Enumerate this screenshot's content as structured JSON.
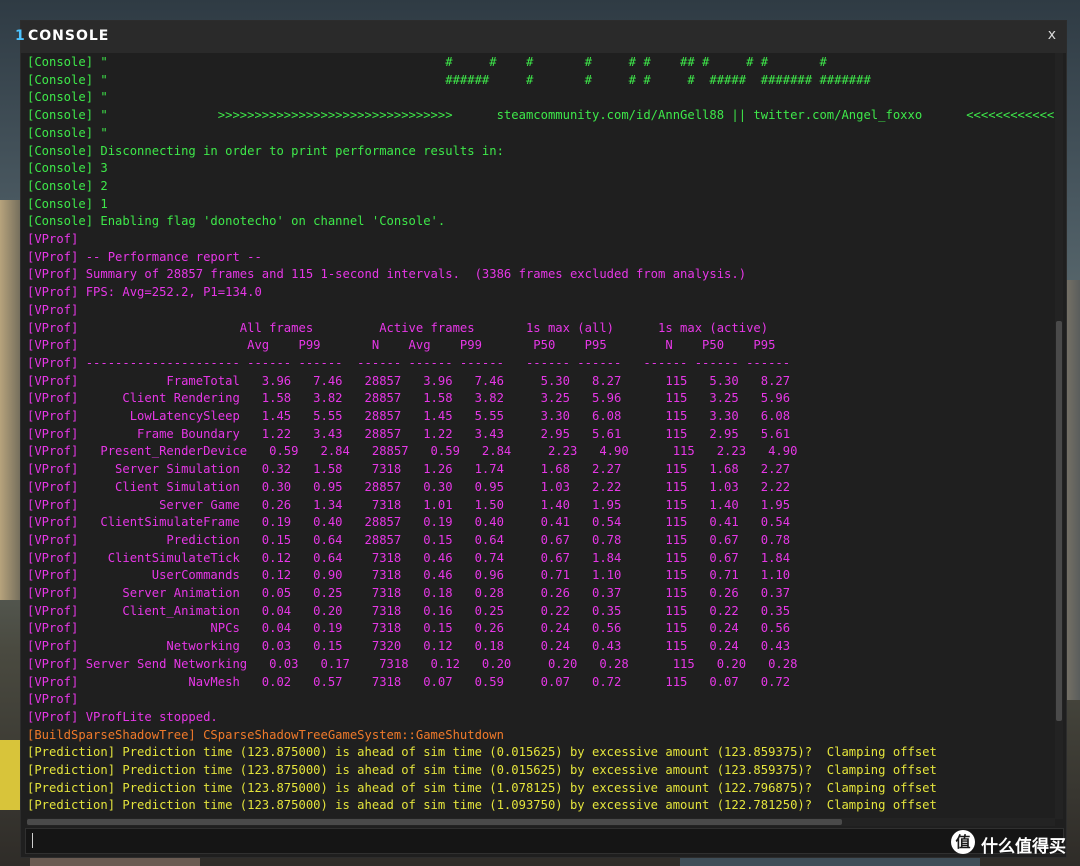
{
  "window": {
    "tab_mark": "1",
    "title": "CONSOLE",
    "close_label": "x"
  },
  "colors": {
    "console": "#3ee84a",
    "vprof": "#e637e6",
    "build": "#f07a2a",
    "prediction": "#e4e43c",
    "plain": "#cfcfcf"
  },
  "log_lines": [
    {
      "color": "console",
      "text": "[Console] \"                                              #     #    #       #     # #    ## #     # #       #"
    },
    {
      "color": "console",
      "text": "[Console] \"                                              ######     #       #     # #     #  #####  ####### #######"
    },
    {
      "color": "console",
      "text": "[Console] \""
    },
    {
      "color": "console",
      "text": "[Console] \"               >>>>>>>>>>>>>>>>>>>>>>>>>>>>>>>>      steamcommunity.com/id/AnnGell88 || twitter.com/Angel_foxxo      <<<<<<<<<<<<"
    },
    {
      "color": "console",
      "text": "[Console] \""
    },
    {
      "color": "console",
      "text": "[Console] Disconnecting in order to print performance results in:"
    },
    {
      "color": "console",
      "text": "[Console] 3"
    },
    {
      "color": "console",
      "text": "[Console] 2"
    },
    {
      "color": "console",
      "text": "[Console] 1"
    },
    {
      "color": "console",
      "text": "[Console] Enabling flag 'donotecho' on channel 'Console'."
    },
    {
      "color": "vprof",
      "text": "[VProf]"
    },
    {
      "color": "vprof",
      "text": "[VProf] -- Performance report --"
    },
    {
      "color": "vprof",
      "text": "[VProf] Summary of 28857 frames and 115 1-second intervals.  (3386 frames excluded from analysis.)"
    },
    {
      "color": "vprof",
      "text": "[VProf] FPS: Avg=252.2, P1=134.0"
    },
    {
      "color": "vprof",
      "text": "[VProf]"
    },
    {
      "color": "vprof",
      "text": "[VProf]                      All frames         Active frames       1s max (all)      1s max (active)"
    },
    {
      "color": "vprof",
      "text": "[VProf]                       Avg    P99       N    Avg    P99       P50    P95        N    P50    P95"
    },
    {
      "color": "vprof",
      "text": "[VProf] --------------------- ------ ------  ------ ------ ------   ------ ------   ------ ------ ------"
    },
    {
      "color": "vprof",
      "text": "[VProf]            FrameTotal   3.96   7.46   28857   3.96   7.46     5.30   8.27      115   5.30   8.27"
    },
    {
      "color": "vprof",
      "text": "[VProf]      Client Rendering   1.58   3.82   28857   1.58   3.82     3.25   5.96      115   3.25   5.96"
    },
    {
      "color": "vprof",
      "text": "[VProf]       LowLatencySleep   1.45   5.55   28857   1.45   5.55     3.30   6.08      115   3.30   6.08"
    },
    {
      "color": "vprof",
      "text": "[VProf]        Frame Boundary   1.22   3.43   28857   1.22   3.43     2.95   5.61      115   2.95   5.61"
    },
    {
      "color": "vprof",
      "text": "[VProf]   Present_RenderDevice   0.59   2.84   28857   0.59   2.84     2.23   4.90      115   2.23   4.90"
    },
    {
      "color": "vprof",
      "text": "[VProf]     Server Simulation   0.32   1.58    7318   1.26   1.74     1.68   2.27      115   1.68   2.27"
    },
    {
      "color": "vprof",
      "text": "[VProf]     Client Simulation   0.30   0.95   28857   0.30   0.95     1.03   2.22      115   1.03   2.22"
    },
    {
      "color": "vprof",
      "text": "[VProf]           Server Game   0.26   1.34    7318   1.01   1.50     1.40   1.95      115   1.40   1.95"
    },
    {
      "color": "vprof",
      "text": "[VProf]   ClientSimulateFrame   0.19   0.40   28857   0.19   0.40     0.41   0.54      115   0.41   0.54"
    },
    {
      "color": "vprof",
      "text": "[VProf]            Prediction   0.15   0.64   28857   0.15   0.64     0.67   0.78      115   0.67   0.78"
    },
    {
      "color": "vprof",
      "text": "[VProf]    ClientSimulateTick   0.12   0.64    7318   0.46   0.74     0.67   1.84      115   0.67   1.84"
    },
    {
      "color": "vprof",
      "text": "[VProf]          UserCommands   0.12   0.90    7318   0.46   0.96     0.71   1.10      115   0.71   1.10"
    },
    {
      "color": "vprof",
      "text": "[VProf]      Server Animation   0.05   0.25    7318   0.18   0.28     0.26   0.37      115   0.26   0.37"
    },
    {
      "color": "vprof",
      "text": "[VProf]      Client_Animation   0.04   0.20    7318   0.16   0.25     0.22   0.35      115   0.22   0.35"
    },
    {
      "color": "vprof",
      "text": "[VProf]                  NPCs   0.04   0.19    7318   0.15   0.26     0.24   0.56      115   0.24   0.56"
    },
    {
      "color": "vprof",
      "text": "[VProf]            Networking   0.03   0.15    7320   0.12   0.18     0.24   0.43      115   0.24   0.43"
    },
    {
      "color": "vprof",
      "text": "[VProf] Server Send Networking   0.03   0.17    7318   0.12   0.20     0.20   0.28      115   0.20   0.28"
    },
    {
      "color": "vprof",
      "text": "[VProf]               NavMesh   0.02   0.57    7318   0.07   0.59     0.07   0.72      115   0.07   0.72"
    },
    {
      "color": "vprof",
      "text": "[VProf]"
    },
    {
      "color": "vprof",
      "text": "[VProf] VProfLite stopped."
    },
    {
      "color": "build",
      "text": "[BuildSparseShadowTree] CSparseShadowTreeGameSystem::GameShutdown"
    },
    {
      "color": "prediction",
      "text": "[Prediction] Prediction time (123.875000) is ahead of sim time (0.015625) by excessive amount (123.859375)?  Clamping offset"
    },
    {
      "color": "prediction",
      "text": "[Prediction] Prediction time (123.875000) is ahead of sim time (0.015625) by excessive amount (123.859375)?  Clamping offset"
    },
    {
      "color": "prediction",
      "text": "[Prediction] Prediction time (123.875000) is ahead of sim time (1.078125) by excessive amount (122.796875)?  Clamping offset"
    },
    {
      "color": "prediction",
      "text": "[Prediction] Prediction time (123.875000) is ahead of sim time (1.093750) by excessive amount (122.781250)?  Clamping offset"
    },
    {
      "color": "prediction",
      "text": "[Prediction] Prediction time (123.875000) is ahead of sim time (1.093750) by excessive amount (122.781250)?  Clamping offset"
    }
  ],
  "input": {
    "value": ""
  },
  "watermark": {
    "logo": "值",
    "text": "什么值得买"
  }
}
